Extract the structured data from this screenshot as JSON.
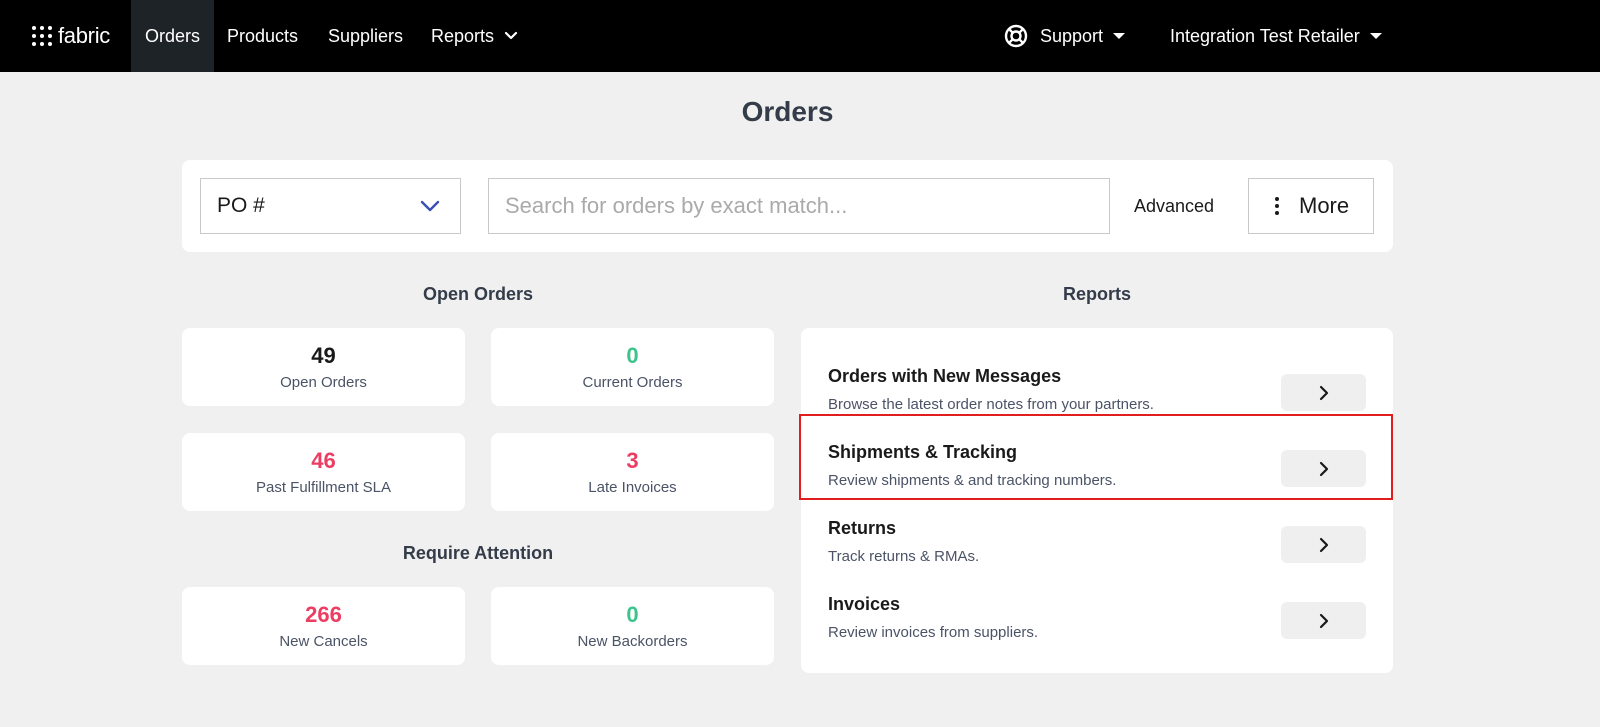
{
  "nav": {
    "logo_text": "fabric",
    "items": [
      {
        "label": "Orders",
        "active": true
      },
      {
        "label": "Products"
      },
      {
        "label": "Suppliers"
      },
      {
        "label": "Reports"
      }
    ],
    "support_label": "Support",
    "account_label": "Integration Test Retailer"
  },
  "page": {
    "title": "Orders"
  },
  "search": {
    "field_select_value": "PO #",
    "placeholder": "Search for orders by exact match...",
    "advanced_label": "Advanced",
    "more_label": "More"
  },
  "open_orders": {
    "heading": "Open Orders",
    "cards": [
      {
        "value": "49",
        "label": "Open Orders",
        "color": "#1a1a1a"
      },
      {
        "value": "0",
        "label": "Current Orders",
        "color": "#3cc48a"
      },
      {
        "value": "46",
        "label": "Past Fulfillment SLA",
        "color": "#ec3d62"
      },
      {
        "value": "3",
        "label": "Late Invoices",
        "color": "#ec3d62"
      }
    ]
  },
  "require_attention": {
    "heading": "Require Attention",
    "cards": [
      {
        "value": "266",
        "label": "New Cancels",
        "color": "#ec3d62"
      },
      {
        "value": "0",
        "label": "New Backorders",
        "color": "#3cc48a"
      }
    ]
  },
  "reports": {
    "heading": "Reports",
    "items": [
      {
        "title": "Orders with New Messages",
        "description": "Browse the latest order notes from your partners."
      },
      {
        "title": "Shipments & Tracking",
        "description": "Review shipments & and tracking numbers.",
        "highlighted": true
      },
      {
        "title": "Returns",
        "description": "Track returns & RMAs."
      },
      {
        "title": "Invoices",
        "description": "Review invoices from suppliers."
      }
    ]
  },
  "colors": {
    "topbar": "#000000",
    "active_nav": "#1e2328",
    "green": "#3cc48a",
    "red": "#ec3d62",
    "highlight": "#e11d1d"
  }
}
